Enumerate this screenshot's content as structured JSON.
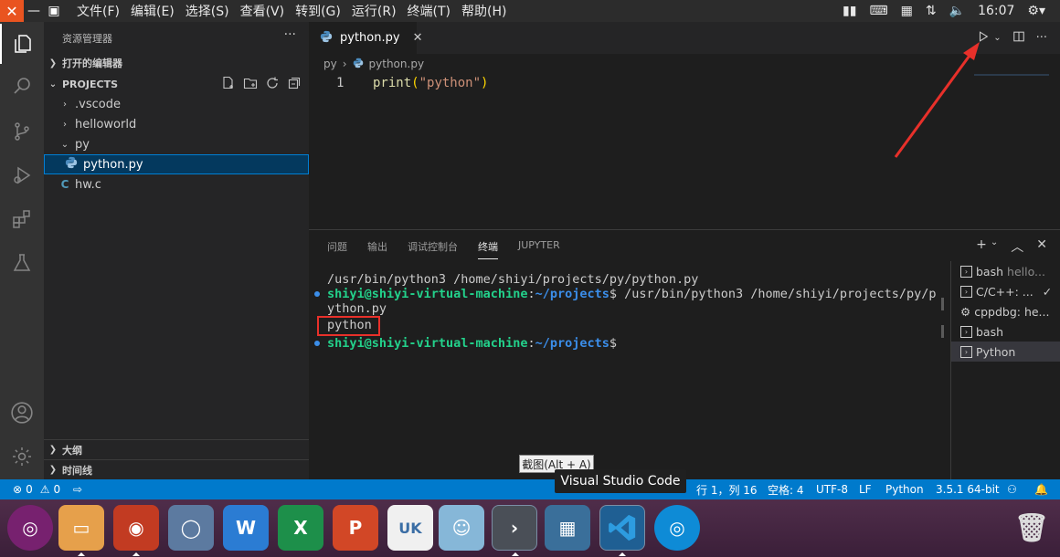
{
  "topbar": {
    "menu": [
      "文件(F)",
      "编辑(E)",
      "选择(S)",
      "查看(V)",
      "转到(G)",
      "运行(R)",
      "终端(T)",
      "帮助(H)"
    ],
    "clock": "16:07"
  },
  "sidebar": {
    "title": "资源管理器",
    "open_editors": "打开的编辑器",
    "projects": "PROJECTS",
    "tree": [
      ".vscode",
      "helloworld",
      "py",
      "python.py",
      "hw.c"
    ],
    "outline": "大纲",
    "timeline": "时间线"
  },
  "editor": {
    "tab_label": "python.py",
    "breadcrumb": [
      "py",
      "python.py"
    ],
    "line_number": "1",
    "code": {
      "fn": "print",
      "open": "(",
      "str": "\"python\"",
      "close": ")"
    }
  },
  "panel": {
    "tabs": [
      "问题",
      "输出",
      "调试控制台",
      "终端",
      "JUPYTER"
    ],
    "terminal": {
      "line1": "/usr/bin/python3 /home/shiyi/projects/py/python.py",
      "user": "shiyi@shiyi-virtual-machine",
      "colon": ":",
      "path": "~/projects",
      "cmd": "$ /usr/bin/python3 /home/shiyi/projects/py/p",
      "cmd_wrap": "ython.py",
      "output": "python",
      "prompt_end": "$"
    },
    "terminals": [
      {
        "name": "bash",
        "detail": "hello..."
      },
      {
        "name": "C/C++: ...",
        "detail": "✓"
      },
      {
        "name": "cppdbg: he...",
        "detail": ""
      },
      {
        "name": "bash",
        "detail": ""
      },
      {
        "name": "Python",
        "detail": ""
      }
    ]
  },
  "status": {
    "errors": "0",
    "warnings": "0",
    "position": "行 1，列 16",
    "spaces": "空格: 4",
    "encoding": "UTF-8",
    "eol": "LF",
    "language": "Python",
    "interpreter": "3.5.1 64-bit"
  },
  "tooltips": {
    "screenshot": "截图(Alt + A)",
    "app": "Visual Studio Code"
  },
  "colors": {
    "accent": "#007acc",
    "annotation": "#e8302a"
  }
}
